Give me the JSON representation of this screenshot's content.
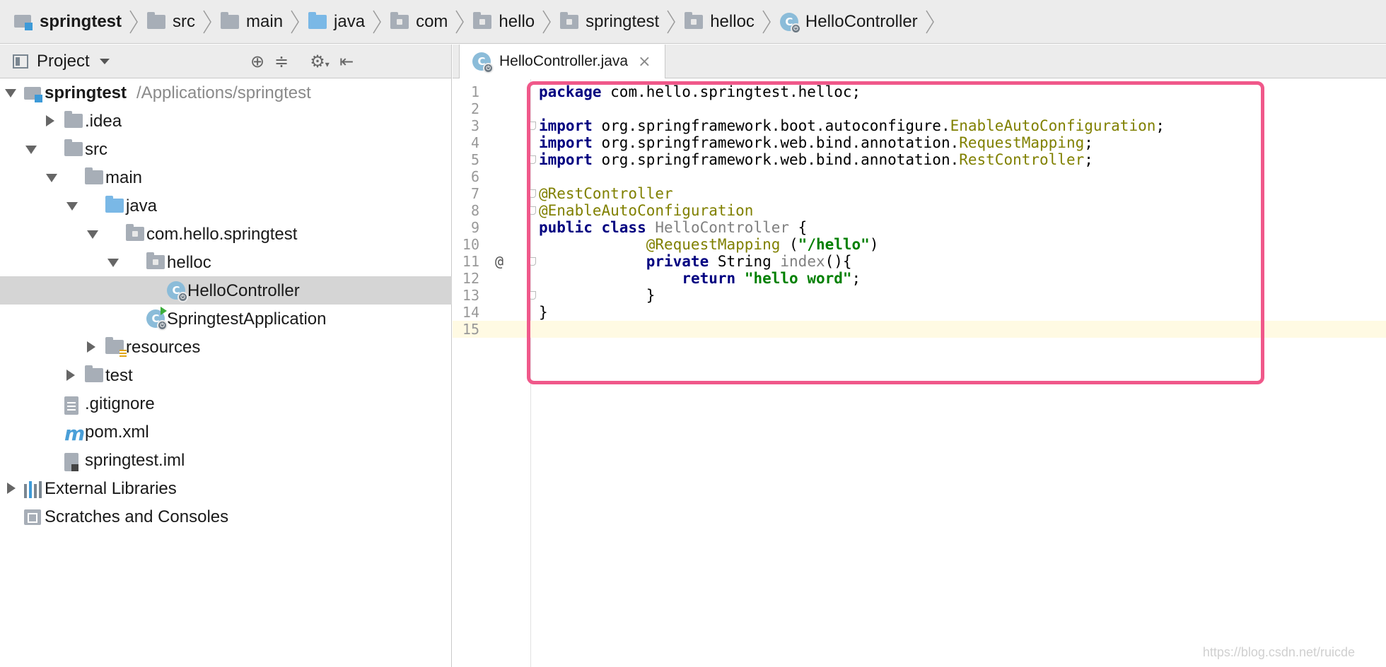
{
  "breadcrumb": [
    {
      "label": "springtest",
      "icon": "project-icon",
      "bold": true
    },
    {
      "label": "src",
      "icon": "folder-icon"
    },
    {
      "label": "main",
      "icon": "folder-icon"
    },
    {
      "label": "java",
      "icon": "source-folder-icon"
    },
    {
      "label": "com",
      "icon": "package-icon"
    },
    {
      "label": "hello",
      "icon": "package-icon"
    },
    {
      "label": "springtest",
      "icon": "package-icon"
    },
    {
      "label": "helloc",
      "icon": "package-icon"
    },
    {
      "label": "HelloController",
      "icon": "spring-class-icon"
    }
  ],
  "project_panel": {
    "title": "Project",
    "tools": [
      "locate-icon",
      "collapse-all-icon",
      "gear-icon",
      "hide-panel-icon"
    ]
  },
  "tree": [
    {
      "label": "springtest",
      "path": "/Applications/springtest",
      "depth": 0,
      "arrow": "down",
      "icon": "project-icon",
      "bold": true
    },
    {
      "label": ".idea",
      "depth": 1,
      "arrow": "right",
      "icon": "folder-icon"
    },
    {
      "label": "src",
      "depth": 1,
      "arrow": "down",
      "icon": "folder-icon"
    },
    {
      "label": "main",
      "depth": 2,
      "arrow": "down",
      "icon": "folder-icon"
    },
    {
      "label": "java",
      "depth": 3,
      "arrow": "down",
      "icon": "source-folder-icon"
    },
    {
      "label": "com.hello.springtest",
      "depth": 4,
      "arrow": "down",
      "icon": "package-icon"
    },
    {
      "label": "helloc",
      "depth": 5,
      "arrow": "down",
      "icon": "package-icon"
    },
    {
      "label": "HelloController",
      "depth": 6,
      "arrow": "none",
      "icon": "spring-class-icon",
      "selected": true
    },
    {
      "label": "SpringtestApplication",
      "depth": 5,
      "arrow": "none",
      "icon": "spring-boot-app-icon"
    },
    {
      "label": "resources",
      "depth": 3,
      "arrow": "right",
      "icon": "resources-folder-icon"
    },
    {
      "label": "test",
      "depth": 2,
      "arrow": "right",
      "icon": "folder-icon"
    },
    {
      "label": ".gitignore",
      "depth": 1,
      "arrow": "none",
      "icon": "text-file-icon"
    },
    {
      "label": "pom.xml",
      "depth": 1,
      "arrow": "none",
      "icon": "maven-icon"
    },
    {
      "label": "springtest.iml",
      "depth": 1,
      "arrow": "none",
      "icon": "iml-file-icon"
    },
    {
      "label": "External Libraries",
      "depth": 0,
      "arrow": "right",
      "icon": "libraries-icon"
    },
    {
      "label": "Scratches and Consoles",
      "depth": 0,
      "arrow": "none",
      "icon": "scratches-icon"
    }
  ],
  "editor": {
    "tab_label": "HelloController.java",
    "close_glyph": "×",
    "lines": [
      {
        "n": "1",
        "tokens": [
          {
            "t": "package",
            "c": "kw"
          },
          {
            "t": " com.hello.springtest.helloc;",
            "c": ""
          }
        ]
      },
      {
        "n": "2",
        "tokens": []
      },
      {
        "n": "3",
        "fold": true,
        "tokens": [
          {
            "t": "import",
            "c": "kw"
          },
          {
            "t": " org.springframework.boot.autoconfigure.",
            "c": ""
          },
          {
            "t": "EnableAutoConfiguration",
            "c": "cls"
          },
          {
            "t": ";",
            "c": ""
          }
        ]
      },
      {
        "n": "4",
        "tokens": [
          {
            "t": "import",
            "c": "kw"
          },
          {
            "t": " org.springframework.web.bind.annotation.",
            "c": ""
          },
          {
            "t": "RequestMapping",
            "c": "cls"
          },
          {
            "t": ";",
            "c": ""
          }
        ]
      },
      {
        "n": "5",
        "fold": true,
        "tokens": [
          {
            "t": "import",
            "c": "kw"
          },
          {
            "t": " org.springframework.web.bind.annotation.",
            "c": ""
          },
          {
            "t": "RestController",
            "c": "cls"
          },
          {
            "t": ";",
            "c": ""
          }
        ]
      },
      {
        "n": "6",
        "tokens": []
      },
      {
        "n": "7",
        "fold": true,
        "tokens": [
          {
            "t": "@RestController",
            "c": "ann"
          }
        ]
      },
      {
        "n": "8",
        "fold": true,
        "tokens": [
          {
            "t": "@EnableAutoConfiguration",
            "c": "ann"
          }
        ]
      },
      {
        "n": "9",
        "tokens": [
          {
            "t": "public class",
            "c": "kw"
          },
          {
            "t": " ",
            "c": ""
          },
          {
            "t": "HelloController",
            "c": "gray"
          },
          {
            "t": " {",
            "c": ""
          }
        ]
      },
      {
        "n": "10",
        "tokens": [
          {
            "t": "            ",
            "c": ""
          },
          {
            "t": "@RequestMapping",
            "c": "ann"
          },
          {
            "t": " (",
            "c": ""
          },
          {
            "t": "\"/hello\"",
            "c": "str"
          },
          {
            "t": ")",
            "c": ""
          }
        ]
      },
      {
        "n": "11",
        "mark": "@",
        "fold": true,
        "tokens": [
          {
            "t": "            ",
            "c": ""
          },
          {
            "t": "private",
            "c": "kw"
          },
          {
            "t": " String ",
            "c": ""
          },
          {
            "t": "index",
            "c": "gray"
          },
          {
            "t": "(){",
            "c": ""
          }
        ]
      },
      {
        "n": "12",
        "tokens": [
          {
            "t": "                ",
            "c": ""
          },
          {
            "t": "return",
            "c": "kw"
          },
          {
            "t": " ",
            "c": ""
          },
          {
            "t": "\"hello word\"",
            "c": "str"
          },
          {
            "t": ";",
            "c": ""
          }
        ]
      },
      {
        "n": "13",
        "fold": true,
        "tokens": [
          {
            "t": "            }",
            "c": ""
          }
        ]
      },
      {
        "n": "14",
        "tokens": [
          {
            "t": "}",
            "c": ""
          }
        ]
      },
      {
        "n": "15",
        "current": true,
        "tokens": []
      }
    ]
  },
  "watermark": "https://blog.csdn.net/ruicde",
  "colors": {
    "keyword": "#000080",
    "annotation": "#808000",
    "string": "#008000",
    "highlight_box": "#f0588a",
    "selection": "#d5d5d5",
    "current_line": "#fffae3"
  }
}
